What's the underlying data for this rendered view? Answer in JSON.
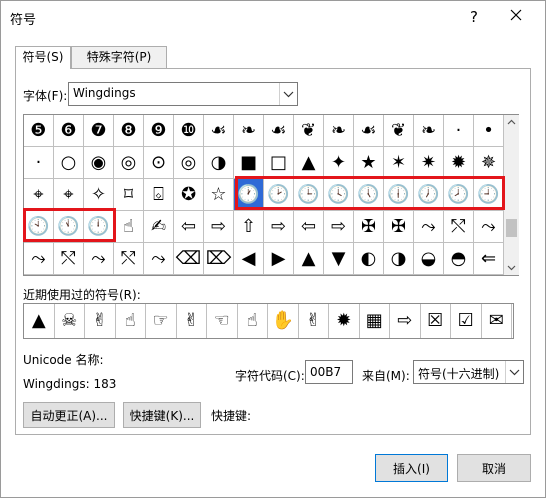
{
  "window": {
    "title": "符号",
    "help": "?",
    "close": "✕"
  },
  "tabs": [
    {
      "label": "符号(S)"
    },
    {
      "label": "特殊字符(P)"
    }
  ],
  "font": {
    "label": "字体(F):",
    "value": "Wingdings"
  },
  "grid": {
    "rows": [
      [
        "❺",
        "❻",
        "❼",
        "❽",
        "❾",
        "❿",
        "☙",
        "❧",
        "☙",
        "❦",
        "❧",
        "☙",
        "❦",
        "❧",
        "·",
        "•"
      ],
      [
        "·",
        "○",
        "◉",
        "◎",
        "⊙",
        "◎",
        "◑",
        "■",
        "□",
        "▲",
        "✦",
        "★",
        "✶",
        "✷",
        "✹",
        "✵"
      ],
      [
        "⌖",
        "⌖",
        "✧",
        "⌑",
        "⌺",
        "✪",
        "☆",
        "🕐",
        "🕑",
        "🕒",
        "🕓",
        "🕔",
        "🕕",
        "🕖",
        "🕗",
        "🕘"
      ],
      [
        "🕙",
        "🕚",
        "🕛",
        "☝",
        "✍",
        "⇦",
        "⇨",
        "⇧",
        "⇨",
        "⇦",
        "⇨",
        "✠",
        "✠",
        "⤳",
        "⤲",
        "⤳"
      ],
      [
        "⤳",
        "⤲",
        "⤳",
        "⤲",
        "⤳",
        "⌫",
        "⌦",
        "◀",
        "▶",
        "▲",
        "▼",
        "◐",
        "◑",
        "◒",
        "◓",
        "⇐"
      ]
    ],
    "selected": [
      2,
      7
    ]
  },
  "recent": {
    "label": "近期使用过的符号(R):",
    "items": [
      "▲",
      "☠",
      "✌",
      "☝",
      "☞",
      "✌",
      "☜",
      "☝",
      "✋",
      "✌",
      "✹",
      "▦",
      "⇨",
      "☒",
      "☑",
      "✉"
    ]
  },
  "unicode": {
    "label": "Unicode 名称:",
    "value": "Wingdings: 183"
  },
  "code": {
    "label": "字符代码(C):",
    "value": "00B7"
  },
  "from": {
    "label": "来自(M):",
    "value": "符号(十六进制)"
  },
  "buttons": {
    "auto": "自动更正(A)...",
    "shortcut": "快捷键(K)...",
    "insert": "插入(I)",
    "cancel": "取消"
  },
  "shortcut_label": "快捷键:",
  "colors": {
    "selected": "#2f6ad6",
    "highlight": "#e3151b"
  }
}
